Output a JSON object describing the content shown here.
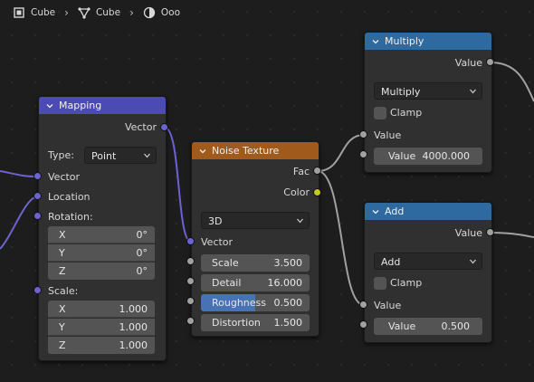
{
  "breadcrumb": {
    "items": [
      {
        "label": "Cube",
        "icon": "object-icon"
      },
      {
        "label": "Cube",
        "icon": "mesh-data-icon"
      },
      {
        "label": "Ooo",
        "icon": "material-icon"
      }
    ]
  },
  "nodes": {
    "mapping": {
      "title": "Mapping",
      "out_vector": "Vector",
      "type_label": "Type:",
      "type_value": "Point",
      "in_vector": "Vector",
      "in_location": "Location",
      "rotation_label": "Rotation:",
      "rotation": [
        {
          "axis": "X",
          "value": "0°"
        },
        {
          "axis": "Y",
          "value": "0°"
        },
        {
          "axis": "Z",
          "value": "0°"
        }
      ],
      "scale_label": "Scale:",
      "scale": [
        {
          "axis": "X",
          "value": "1.000"
        },
        {
          "axis": "Y",
          "value": "1.000"
        },
        {
          "axis": "Z",
          "value": "1.000"
        }
      ]
    },
    "noise": {
      "title": "Noise Texture",
      "out_fac": "Fac",
      "out_color": "Color",
      "dimensions": "3D",
      "in_vector": "Vector",
      "fields": [
        {
          "label": "Scale",
          "value": "3.500"
        },
        {
          "label": "Detail",
          "value": "16.000"
        },
        {
          "label": "Roughness",
          "value": "0.500",
          "fill": 0.5
        },
        {
          "label": "Distortion",
          "value": "1.500"
        }
      ]
    },
    "multiply": {
      "title": "Multiply",
      "out_value": "Value",
      "operation": "Multiply",
      "clamp_label": "Clamp",
      "in_value_label": "Value",
      "value_field": {
        "label": "Value",
        "value": "4000.000"
      }
    },
    "add": {
      "title": "Add",
      "out_value": "Value",
      "operation": "Add",
      "clamp_label": "Clamp",
      "in_value_label": "Value",
      "value_field": {
        "label": "Value",
        "value": "0.500"
      }
    }
  },
  "colors": {
    "vector_header": "#4c4ab4",
    "texture_header": "#a05a1c",
    "converter_header": "#2e6aa0",
    "vector_socket": "#6c63d2",
    "float_socket": "#a1a1a1",
    "color_socket": "#c7c729"
  }
}
